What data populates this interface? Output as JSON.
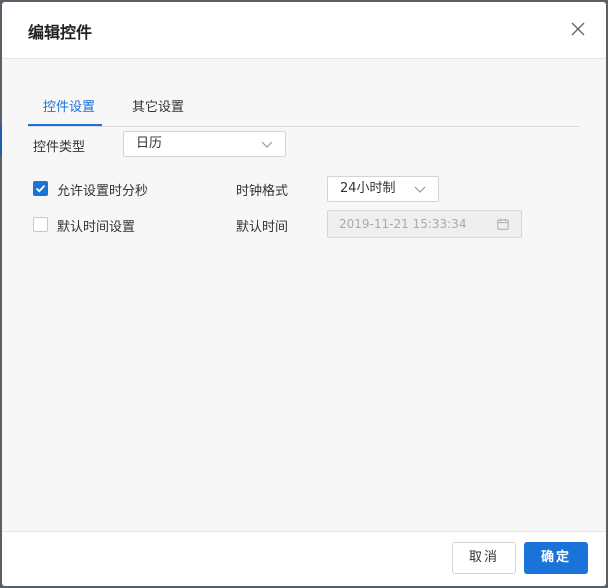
{
  "dialog": {
    "title": "编辑控件"
  },
  "tabs": [
    {
      "label": "控件设置",
      "active": true
    },
    {
      "label": "其它设置",
      "active": false
    }
  ],
  "control_type": {
    "label": "控件类型",
    "value": "日历"
  },
  "allow_seconds": {
    "label": "允许设置时分秒",
    "checked": true
  },
  "clock_format": {
    "label": "时钟格式",
    "value": "24小时制"
  },
  "default_time_setting": {
    "label": "默认时间设置",
    "checked": false
  },
  "default_time": {
    "label": "默认时间",
    "value": "2019-11-21 15:33:34"
  },
  "footer": {
    "cancel_label": "取消",
    "ok_label": "确定"
  },
  "colors": {
    "accent": "#1a73d9"
  },
  "icons": {
    "close": "close-icon",
    "dropdown": "chevron-down-icon",
    "calendar": "calendar-icon",
    "check": "check-icon"
  }
}
